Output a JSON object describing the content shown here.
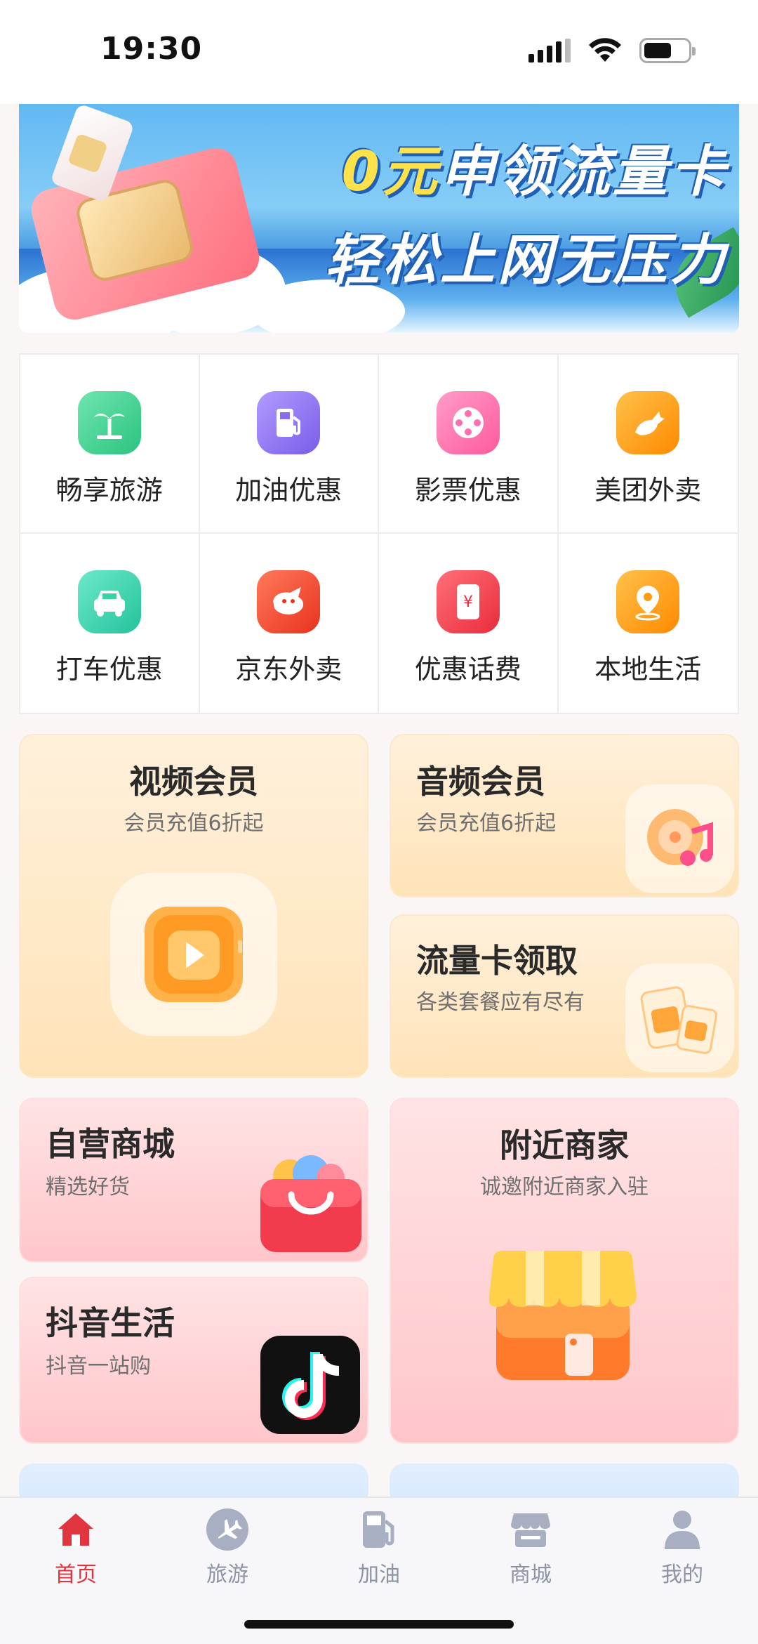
{
  "status_bar": {
    "time": "19:30"
  },
  "banner": {
    "line1_accent": "0元",
    "line1_rest": "申领流量卡",
    "line2": "轻松上网无压力"
  },
  "quick_items": [
    {
      "label": "畅享旅游",
      "icon": "palm-tree-icon",
      "color": "#3dd18f"
    },
    {
      "label": "加油优惠",
      "icon": "fuel-pump-icon",
      "color": "#8b6cf0"
    },
    {
      "label": "影票优惠",
      "icon": "film-reel-icon",
      "color": "#ff6fae"
    },
    {
      "label": "美团外卖",
      "icon": "kangaroo-icon",
      "color": "#ff9c1a"
    },
    {
      "label": "打车优惠",
      "icon": "taxi-icon",
      "color": "#34d3a8"
    },
    {
      "label": "京东外卖",
      "icon": "jd-dog-icon",
      "color": "#f24a2e"
    },
    {
      "label": "优惠话费",
      "icon": "phone-yuan-icon",
      "color": "#f23a4a"
    },
    {
      "label": "本地生活",
      "icon": "location-pin-icon",
      "color": "#ff9d12"
    }
  ],
  "cards": {
    "video": {
      "title": "视频会员",
      "subtitle": "会员充值6折起"
    },
    "audio": {
      "title": "音频会员",
      "subtitle": "会员充值6折起"
    },
    "simcard": {
      "title": "流量卡领取",
      "subtitle": "各类套餐应有尽有"
    },
    "mall": {
      "title": "自营商城",
      "subtitle": "精选好货"
    },
    "douyin": {
      "title": "抖音生活",
      "subtitle": "抖音一站购"
    },
    "nearby": {
      "title": "附近商家",
      "subtitle": "诚邀附近商家入驻"
    }
  },
  "tabbar": {
    "tabs": [
      {
        "label": "首页",
        "icon": "home-icon",
        "active": true
      },
      {
        "label": "旅游",
        "icon": "airplane-icon",
        "active": false
      },
      {
        "label": "加油",
        "icon": "fuel-pump-icon",
        "active": false
      },
      {
        "label": "商城",
        "icon": "store-icon",
        "active": false
      },
      {
        "label": "我的",
        "icon": "person-icon",
        "active": false
      }
    ]
  },
  "colors": {
    "accent": "#e0343f",
    "tab_inactive": "#8c93a6"
  }
}
